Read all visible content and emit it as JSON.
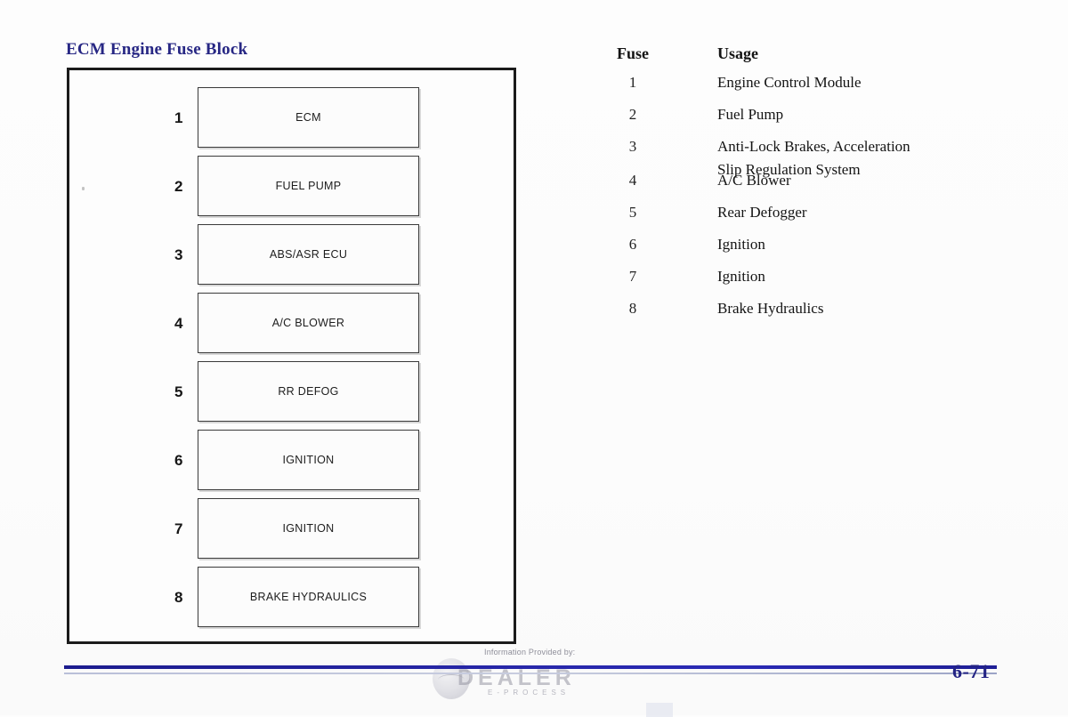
{
  "page": {
    "title": "ECM Engine Fuse Block",
    "page_number": "6-71",
    "title_color": "#272784",
    "rule_color": "#2626a5"
  },
  "diagram": {
    "fuses": [
      {
        "number": "1",
        "label": "ECM"
      },
      {
        "number": "2",
        "label": "FUEL PUMP"
      },
      {
        "number": "3",
        "label": "ABS/ASR ECU"
      },
      {
        "number": "4",
        "label": "A/C BLOWER"
      },
      {
        "number": "5",
        "label": "RR DEFOG"
      },
      {
        "number": "6",
        "label": "IGNITION"
      },
      {
        "number": "7",
        "label": "IGNITION"
      },
      {
        "number": "8",
        "label": "BRAKE HYDRAULICS"
      }
    ]
  },
  "usage_table": {
    "headers": {
      "fuse": "Fuse",
      "usage": "Usage"
    },
    "rows": [
      {
        "fuse": "1",
        "usage": "Engine Control Module"
      },
      {
        "fuse": "2",
        "usage": "Fuel Pump"
      },
      {
        "fuse": "3",
        "usage_line1": "Anti-Lock Brakes, Acceleration",
        "usage_line2": "Slip Regulation System"
      },
      {
        "fuse": "4",
        "usage": "A/C Blower"
      },
      {
        "fuse": "5",
        "usage": "Rear Defogger"
      },
      {
        "fuse": "6",
        "usage": "Ignition"
      },
      {
        "fuse": "7",
        "usage": "Ignition"
      },
      {
        "fuse": "8",
        "usage": "Brake Hydraulics"
      }
    ]
  },
  "watermark": {
    "provided_by": "Information Provided by:",
    "brand": "DEALER",
    "tagline": "E-PROCESS"
  }
}
